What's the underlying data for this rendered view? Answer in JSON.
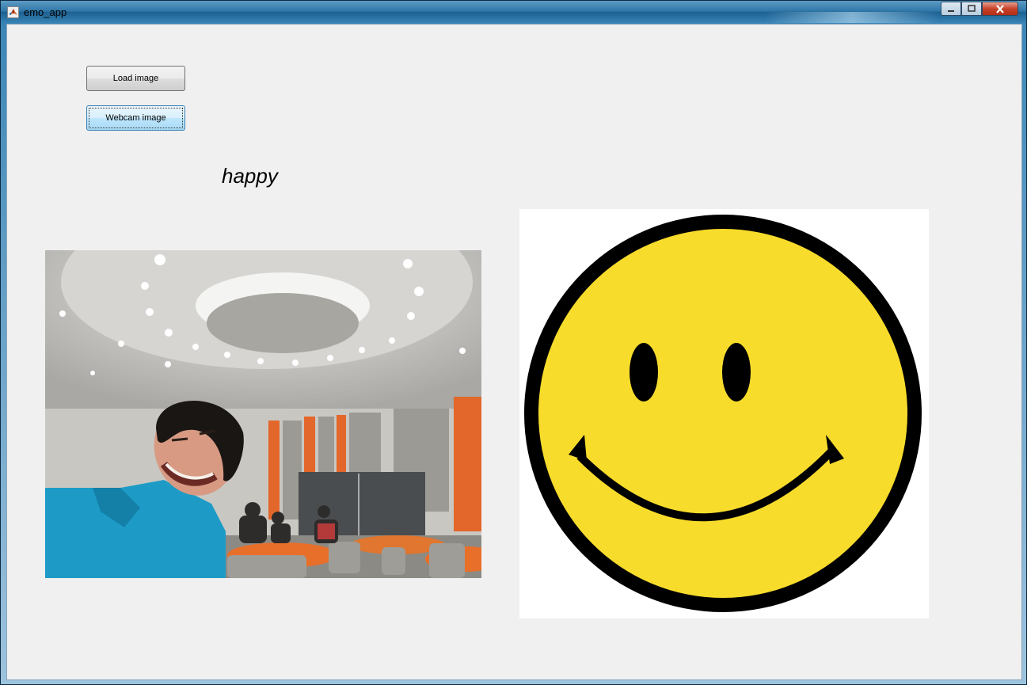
{
  "window": {
    "title": "emo_app"
  },
  "controls": {
    "load_label": "Load image",
    "webcam_label": "Webcam image"
  },
  "result": {
    "label": "happy"
  },
  "icons": {
    "app": "matlab-icon",
    "minimize": "minimize-icon",
    "maximize": "maximize-icon",
    "close": "close-icon"
  },
  "colors": {
    "smiley_face": "#f8dc2b",
    "smiley_outline": "#000000",
    "focused_button": "#bee6fd"
  }
}
